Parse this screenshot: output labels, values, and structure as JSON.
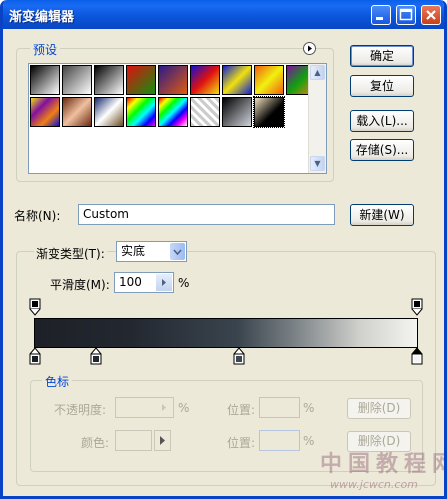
{
  "window": {
    "title": "渐变编辑器"
  },
  "presets": {
    "legend": "预设",
    "swatches": [
      {
        "name": "foreground-to-background",
        "css": "linear-gradient(135deg,#000,#fff)"
      },
      {
        "name": "foreground-to-transparent",
        "css": "linear-gradient(135deg,#444,#fff)"
      },
      {
        "name": "black-white",
        "css": "linear-gradient(135deg,#000,#fff)"
      },
      {
        "name": "red-green",
        "css": "linear-gradient(135deg,#e01010,#109010)"
      },
      {
        "name": "violet-orange",
        "css": "linear-gradient(135deg,#2a1a8a,#e05a10)"
      },
      {
        "name": "blue-red-yellow",
        "css": "linear-gradient(135deg,#1010d0,#e01010,#f0e010)"
      },
      {
        "name": "blue-yellow-blue",
        "css": "linear-gradient(135deg,#1020d0,#f0e010,#1020d0)"
      },
      {
        "name": "orange-yellow-orange",
        "css": "linear-gradient(135deg,#f06010,#f0f010,#f06010)"
      },
      {
        "name": "violet-green-orange",
        "css": "linear-gradient(135deg,#8010a0,#10a010,#f08010)"
      },
      {
        "name": "yellow-violet-orange-blue",
        "css": "linear-gradient(135deg,#f0e010,#8010a0,#f08010,#1010d0)"
      },
      {
        "name": "copper",
        "css": "linear-gradient(135deg,#6a2a10,#f0c0a0,#6a2a10)"
      },
      {
        "name": "chrome",
        "css": "linear-gradient(135deg,#1a2a6a,#fff,#6a4a20)"
      },
      {
        "name": "spectrum",
        "css": "linear-gradient(135deg,#f00,#ff0,#0f0,#0ff,#00f,#f0f)"
      },
      {
        "name": "transparent-rainbow",
        "css": "linear-gradient(135deg,#f00,#ff0,#0f0,#0ff,#00f,#f0f,#fff)"
      },
      {
        "name": "transparent-stripes",
        "css": "repeating-linear-gradient(45deg,#ccc 0 3px,#fff 3px 6px)"
      },
      {
        "name": "neutral-density",
        "css": "linear-gradient(135deg,#000,#d0d4dc)"
      },
      {
        "name": "custom-selected",
        "css": "linear-gradient(135deg,#f0e0c0,#000 60%)"
      }
    ]
  },
  "buttons": {
    "ok": "确定",
    "reset": "复位",
    "load": "载入(L)...",
    "save": "存储(S)...",
    "new": "新建(W)"
  },
  "name": {
    "label": "名称(N):",
    "value": "Custom"
  },
  "gradient": {
    "type_label": "渐变类型(T):",
    "type_value": "实底",
    "smoothness_label": "平滑度(M):",
    "smoothness_value": "100",
    "smoothness_unit": "%"
  },
  "stops": {
    "legend": "色标",
    "opacity_label": "不透明度:",
    "opacity_unit": "%",
    "location_label": "位置:",
    "location_unit": "%",
    "delete_label": "删除(D)",
    "color_label": "颜色:",
    "color_location_label": "位置:",
    "color_location_unit": "%",
    "color_delete_label": "删除(D)"
  },
  "watermark": {
    "text": "中国教程网",
    "url": "www.jcwcn.com"
  }
}
